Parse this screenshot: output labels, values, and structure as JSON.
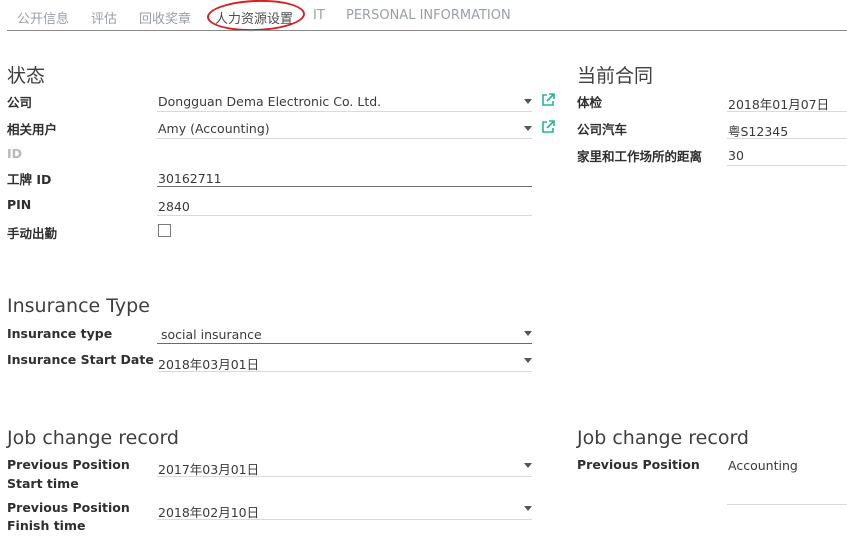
{
  "tabs": [
    "公开信息",
    "评估",
    "回收奖章",
    "人力资源设置",
    "IT",
    "PERSONAL INFORMATION"
  ],
  "status": {
    "heading": "状态",
    "company_label": "公司",
    "company_value": "Dongguan Dema Electronic Co. Ltd.",
    "user_label": "相关用户",
    "user_value": "Amy (Accounting)",
    "id_label": "ID",
    "badge_label": "工牌 ID",
    "badge_value": "30162711",
    "pin_label": "PIN",
    "pin_value": "2840",
    "manual_label": "手动出勤"
  },
  "contract": {
    "heading": "当前合同",
    "medical_label": "体检",
    "medical_value": "2018年01月07日",
    "car_label": "公司汽车",
    "car_value": "粤S12345",
    "distance_label": "家里和工作场所的距离",
    "distance_value": "30"
  },
  "insurance": {
    "heading": "Insurance Type",
    "type_label": "Insurance type",
    "type_value": "social insurance",
    "start_label": "Insurance Start Date",
    "start_value": "2018年03月01日"
  },
  "job_left": {
    "heading": "Job change record",
    "start_label_1": "Previous Position",
    "start_label_2": "Start time",
    "start_value": "2017年03月01日",
    "finish_label_1": "Previous Position",
    "finish_label_2": "Finish time",
    "finish_value": "2018年02月10日"
  },
  "job_right": {
    "heading": "Job change record",
    "position_label": "Previous Position",
    "position_value": "Accounting"
  },
  "colors": {
    "external_link": "#21b799",
    "annotation": "#d62020"
  },
  "icons": [
    "external-link-icon",
    "chevron-down-icon"
  ]
}
